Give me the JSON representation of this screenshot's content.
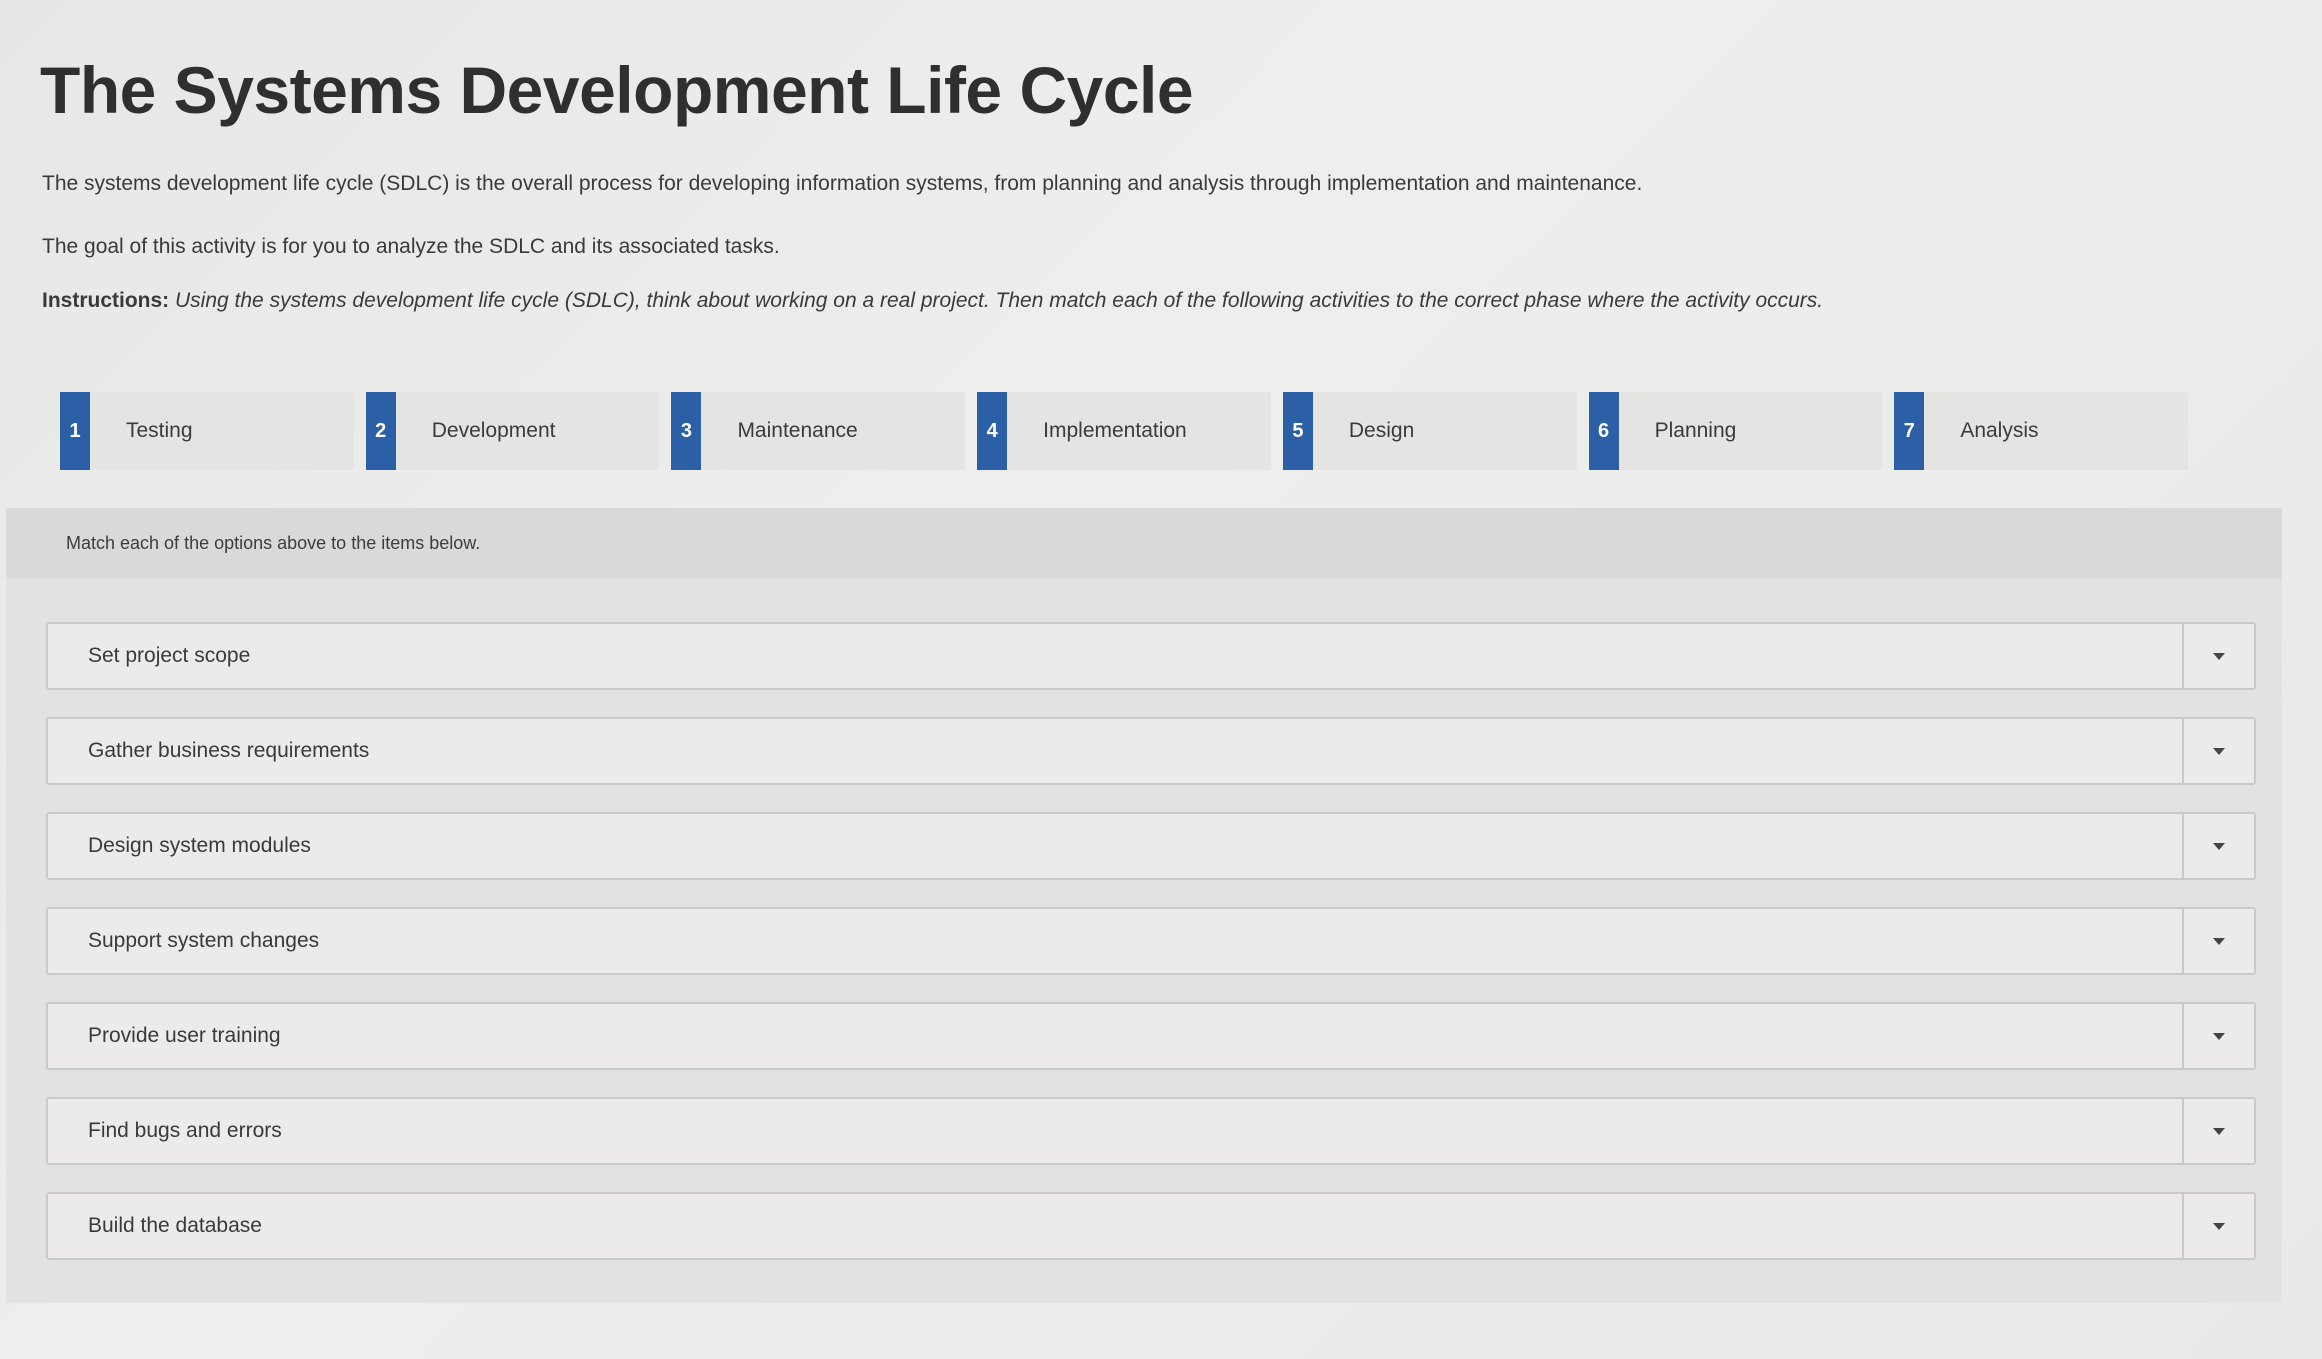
{
  "header": {
    "title": "The Systems Development Life Cycle"
  },
  "intro": {
    "p1": "The systems development life cycle (SDLC) is the overall process for developing information systems, from planning and analysis through implementation and maintenance.",
    "p2": "The goal of this activity is for you to analyze the SDLC and its associated tasks.",
    "instructions_label": "Instructions:",
    "instructions_text": "Using the systems development life cycle (SDLC), think about working on a real project. Then match each of the following activities to the correct phase where the activity occurs."
  },
  "options": [
    {
      "number": "1",
      "label": "Testing"
    },
    {
      "number": "2",
      "label": "Development"
    },
    {
      "number": "3",
      "label": "Maintenance"
    },
    {
      "number": "4",
      "label": "Implementation"
    },
    {
      "number": "5",
      "label": "Design"
    },
    {
      "number": "6",
      "label": "Planning"
    },
    {
      "number": "7",
      "label": "Analysis"
    }
  ],
  "match": {
    "header": "Match each of the options above to the items below.",
    "items": [
      {
        "label": "Set project scope"
      },
      {
        "label": "Gather business requirements"
      },
      {
        "label": "Design system modules"
      },
      {
        "label": "Support system changes"
      },
      {
        "label": "Provide user training"
      },
      {
        "label": "Find bugs and errors"
      },
      {
        "label": "Build the database"
      }
    ]
  },
  "colors": {
    "badge": "#2b5fa6",
    "background": "#eeeeec"
  },
  "icons": {
    "dropdown": "chevron-down-icon"
  }
}
